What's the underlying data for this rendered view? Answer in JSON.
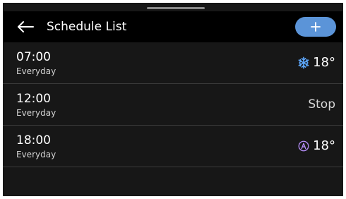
{
  "header": {
    "title": "Schedule List",
    "back_icon": "arrow-left-icon",
    "add_icon": "plus-icon",
    "accent": "#5b94d8"
  },
  "rows": [
    {
      "time": "07:00",
      "repeat": "Everyday",
      "mode_icon": "snowflake-icon",
      "temp": "18°",
      "mode_color": "#5ea9ff"
    },
    {
      "time": "12:00",
      "repeat": "Everyday",
      "status": "Stop"
    },
    {
      "time": "18:00",
      "repeat": "Everyday",
      "mode_icon": "auto-mode-icon",
      "temp": "18°",
      "mode_color": "#b38cf5"
    }
  ]
}
